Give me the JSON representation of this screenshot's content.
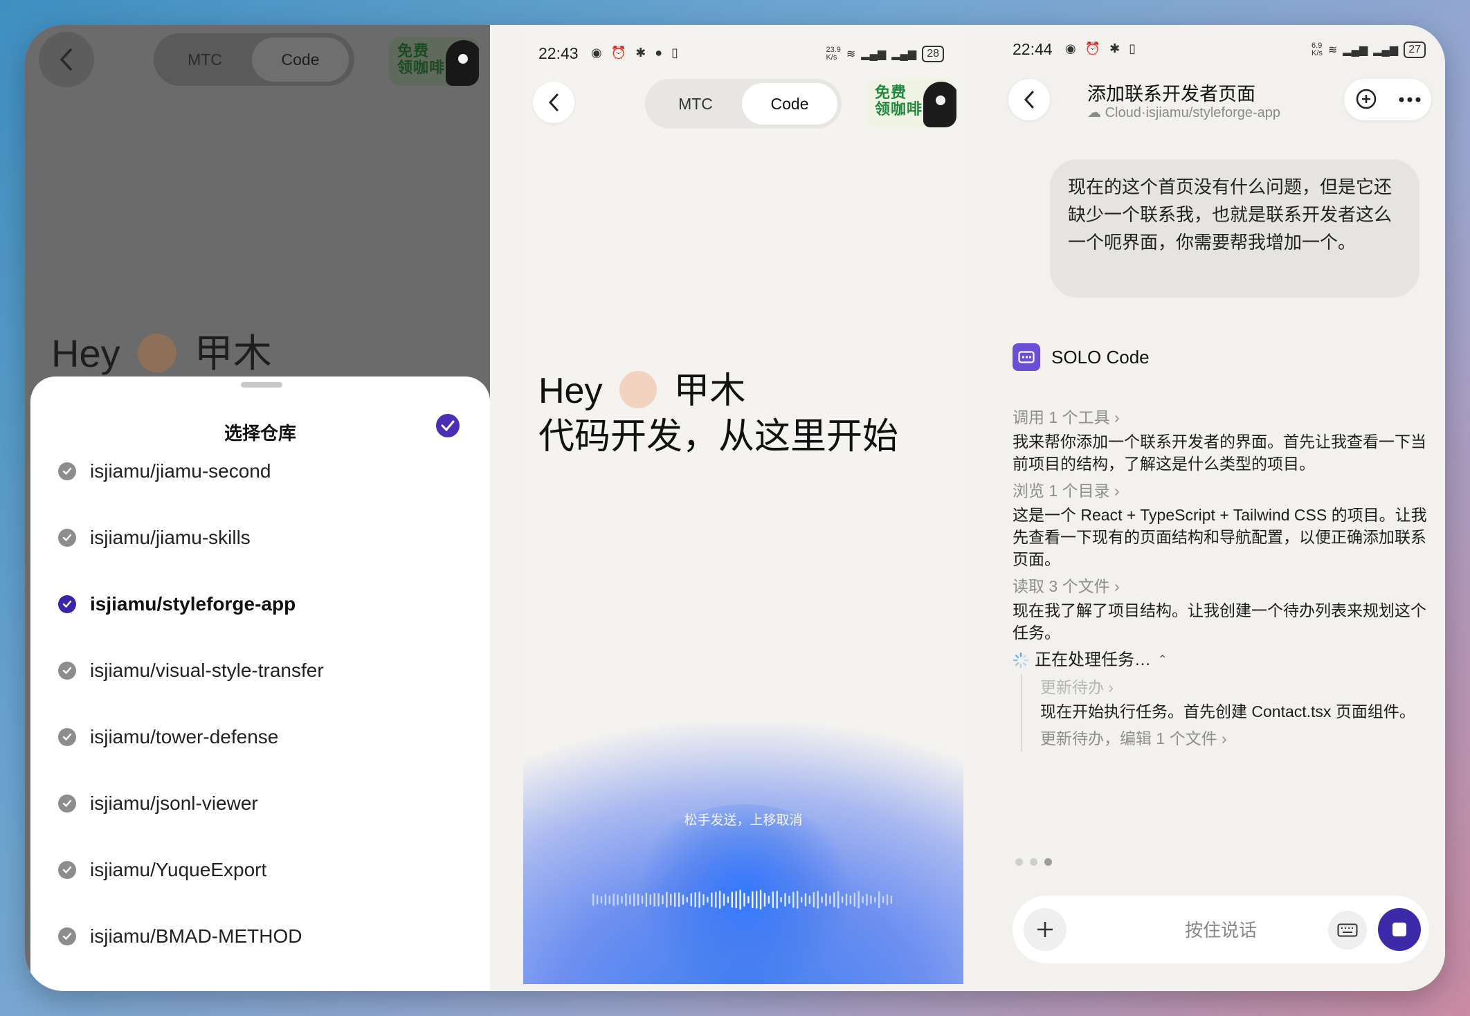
{
  "panel1": {
    "toggle": [
      "MTC",
      "Code"
    ],
    "active_tab": "Code",
    "promo": "免费\n领咖啡",
    "greeting_hey": "Hey",
    "greeting_name": "甲木",
    "sheet_title": "选择仓库",
    "repos": [
      {
        "name": "isjiamu/jiamu-second",
        "selected": false
      },
      {
        "name": "isjiamu/jiamu-skills",
        "selected": false
      },
      {
        "name": "isjiamu/styleforge-app",
        "selected": true
      },
      {
        "name": "isjiamu/visual-style-transfer",
        "selected": false
      },
      {
        "name": "isjiamu/tower-defense",
        "selected": false
      },
      {
        "name": "isjiamu/jsonl-viewer",
        "selected": false
      },
      {
        "name": "isjiamu/YuqueExport",
        "selected": false
      },
      {
        "name": "isjiamu/BMAD-METHOD",
        "selected": false
      }
    ]
  },
  "panel2": {
    "time": "22:43",
    "net_speed": "23.9\nK/s",
    "battery": "28",
    "toggle": [
      "MTC",
      "Code"
    ],
    "active_tab": "Code",
    "promo": "免费\n领咖啡",
    "hero_line1_hey": "Hey",
    "hero_line1_name": "甲木",
    "hero_line2": "代码开发，从这里开始",
    "release_hint": "松手发送，上移取消"
  },
  "panel3": {
    "time": "22:44",
    "net_speed": "6.9\nK/s",
    "battery": "27",
    "title": "添加联系开发者页面",
    "subtitle": "Cloud·isjiamu/styleforge-app",
    "user_message": "现在的这个首页没有什么问题，但是它还缺少一个联系我，也就是联系开发者这么一个呃界面，你需要帮我增加一个。",
    "agent_name": "SOLO Code",
    "steps": [
      {
        "kind": "tool",
        "text": "调用 1 个工具 ›"
      },
      {
        "kind": "msg",
        "text": "我来帮你添加一个联系开发者的界面。首先让我查看一下当前项目的结构，了解这是什么类型的项目。"
      },
      {
        "kind": "tool",
        "text": "浏览 1 个目录 ›"
      },
      {
        "kind": "msg",
        "text": "这是一个 React + TypeScript + Tailwind CSS 的项目。让我先查看一下现有的页面结构和导航配置，以便正确添加联系页面。"
      },
      {
        "kind": "tool",
        "text": "读取 3 个文件 ›"
      },
      {
        "kind": "msg",
        "text": "现在我了解了项目结构。让我创建一个待办列表来规划这个任务。"
      }
    ],
    "processing": "正在处理任务…",
    "sub_steps": [
      {
        "kind": "tool-faint",
        "text": "更新待办 ›"
      },
      {
        "kind": "msg",
        "text": "现在开始执行任务。首先创建 Contact.tsx 页面组件。"
      },
      {
        "kind": "tool",
        "text": "更新待办，编辑 1 个文件 ›"
      }
    ],
    "input_placeholder": "按住说话",
    "colors": {
      "accent": "#3d2aa8"
    }
  }
}
